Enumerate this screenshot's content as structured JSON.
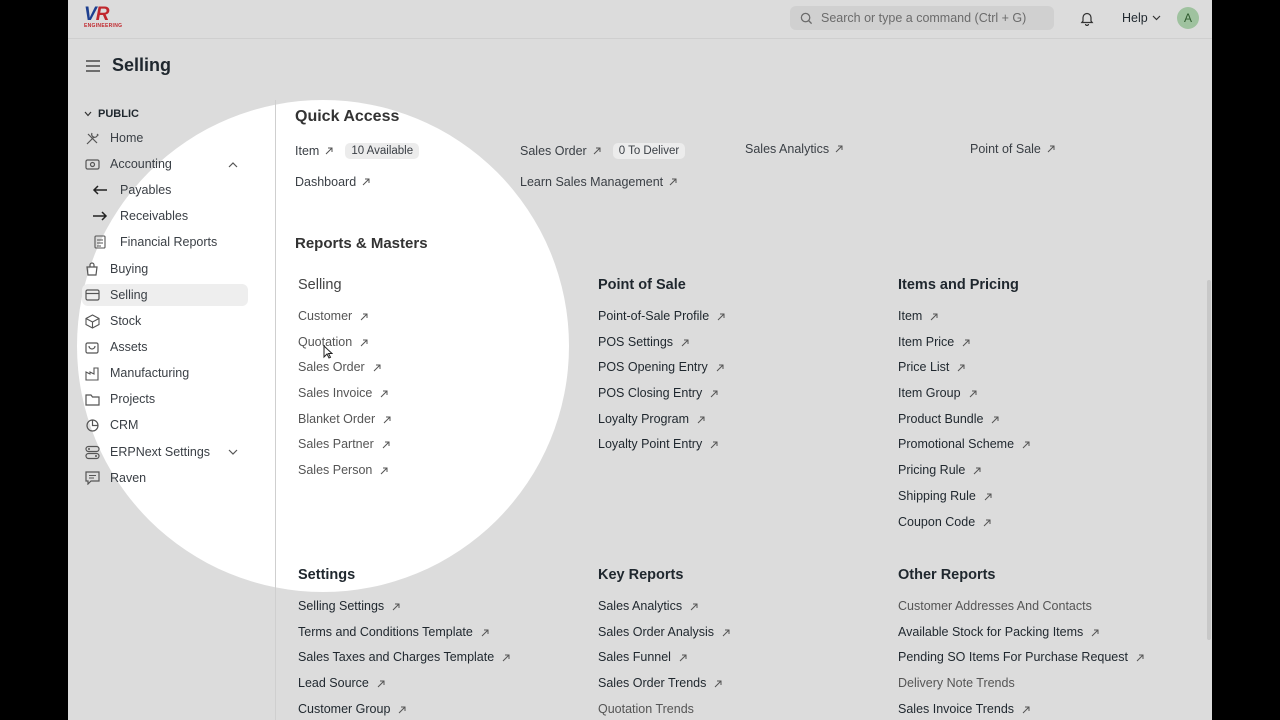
{
  "navbar": {
    "logo_text_blue": "V",
    "logo_text_red": "R",
    "logo_sub": "ENGINEERING",
    "search_placeholder": "Search or type a command (Ctrl + G)",
    "help_label": "Help",
    "avatar_initial": "A"
  },
  "page": {
    "title": "Selling"
  },
  "sidebar": {
    "section_label": "PUBLIC",
    "items": [
      {
        "label": "Home",
        "icon": "tools-icon"
      },
      {
        "label": "Accounting",
        "icon": "accounting-icon"
      },
      {
        "label": "Payables",
        "icon": "arrow-left-icon"
      },
      {
        "label": "Receivables",
        "icon": "arrow-right-icon"
      },
      {
        "label": "Financial Reports",
        "icon": "report-icon"
      },
      {
        "label": "Buying",
        "icon": "buying-icon"
      },
      {
        "label": "Selling",
        "icon": "selling-icon"
      },
      {
        "label": "Stock",
        "icon": "stock-icon"
      },
      {
        "label": "Assets",
        "icon": "assets-icon"
      },
      {
        "label": "Manufacturing",
        "icon": "factory-icon"
      },
      {
        "label": "Projects",
        "icon": "folder-icon"
      },
      {
        "label": "CRM",
        "icon": "crm-icon"
      },
      {
        "label": "ERPNext Settings",
        "icon": "settings-icon"
      },
      {
        "label": "Raven",
        "icon": "chat-icon"
      }
    ]
  },
  "quick_access": {
    "heading": "Quick Access",
    "links": [
      {
        "label": "Item",
        "badge": "10 Available"
      },
      {
        "label": "Sales Order",
        "badge": "0 To Deliver"
      },
      {
        "label": "Sales Analytics"
      },
      {
        "label": "Point of Sale"
      },
      {
        "label": "Dashboard"
      },
      {
        "label": "Learn Sales Management"
      }
    ]
  },
  "reports": {
    "heading": "Reports & Masters",
    "cards": [
      {
        "title": "Selling",
        "links": [
          "Customer",
          "Quotation",
          "Sales Order",
          "Sales Invoice",
          "Blanket Order",
          "Sales Partner",
          "Sales Person"
        ]
      },
      {
        "title": "Point of Sale",
        "links": [
          "Point-of-Sale Profile",
          "POS Settings",
          "POS Opening Entry",
          "POS Closing Entry",
          "Loyalty Program",
          "Loyalty Point Entry"
        ]
      },
      {
        "title": "Items and Pricing",
        "links": [
          "Item",
          "Item Price",
          "Price List",
          "Item Group",
          "Product Bundle",
          "Promotional Scheme",
          "Pricing Rule",
          "Shipping Rule",
          "Coupon Code"
        ]
      },
      {
        "title": "Settings",
        "links": [
          "Selling Settings",
          "Terms and Conditions Template",
          "Sales Taxes and Charges Template",
          "Lead Source",
          "Customer Group"
        ]
      },
      {
        "title": "Key Reports",
        "links": [
          "Sales Analytics",
          "Sales Order Analysis",
          "Sales Funnel",
          "Sales Order Trends",
          "Quotation Trends"
        ]
      },
      {
        "title": "Other Reports",
        "links": [
          "Customer Addresses And Contacts",
          "Available Stock for Packing Items",
          "Pending SO Items For Purchase Request",
          "Delivery Note Trends",
          "Sales Invoice Trends"
        ]
      }
    ]
  }
}
